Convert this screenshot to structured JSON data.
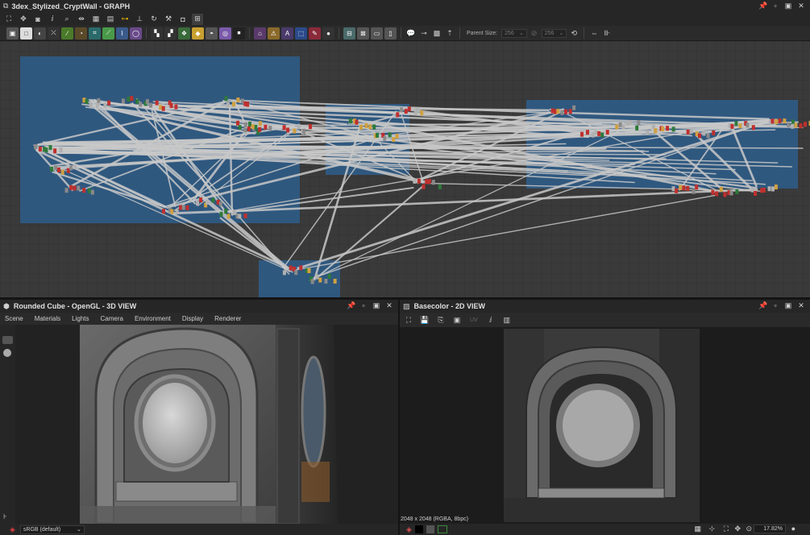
{
  "graph": {
    "title": "3dex_Stylized_CryptWall - GRAPH",
    "parent_size_label": "Parent Size:",
    "parent_size_value": "256",
    "size_value_2": "256"
  },
  "view3d": {
    "title": "Rounded Cube - OpenGL - 3D VIEW",
    "menu": [
      "Scene",
      "Materials",
      "Lights",
      "Camera",
      "Environment",
      "Display",
      "Renderer"
    ],
    "colorspace": "sRGB (default)"
  },
  "view2d": {
    "title": "Basecolor - 2D VIEW",
    "uv_label": "UV",
    "info": "2048 x 2048 (RGBA, 8bpc)",
    "zoom": "17.82%"
  },
  "icons": {
    "panel": "graph-panel-icon",
    "cube": "cube-icon",
    "image": "image-icon"
  },
  "colors": {
    "frame_blue": "#2f5b85",
    "wire": "#c8c8c8",
    "node_red": "#c0302e"
  }
}
